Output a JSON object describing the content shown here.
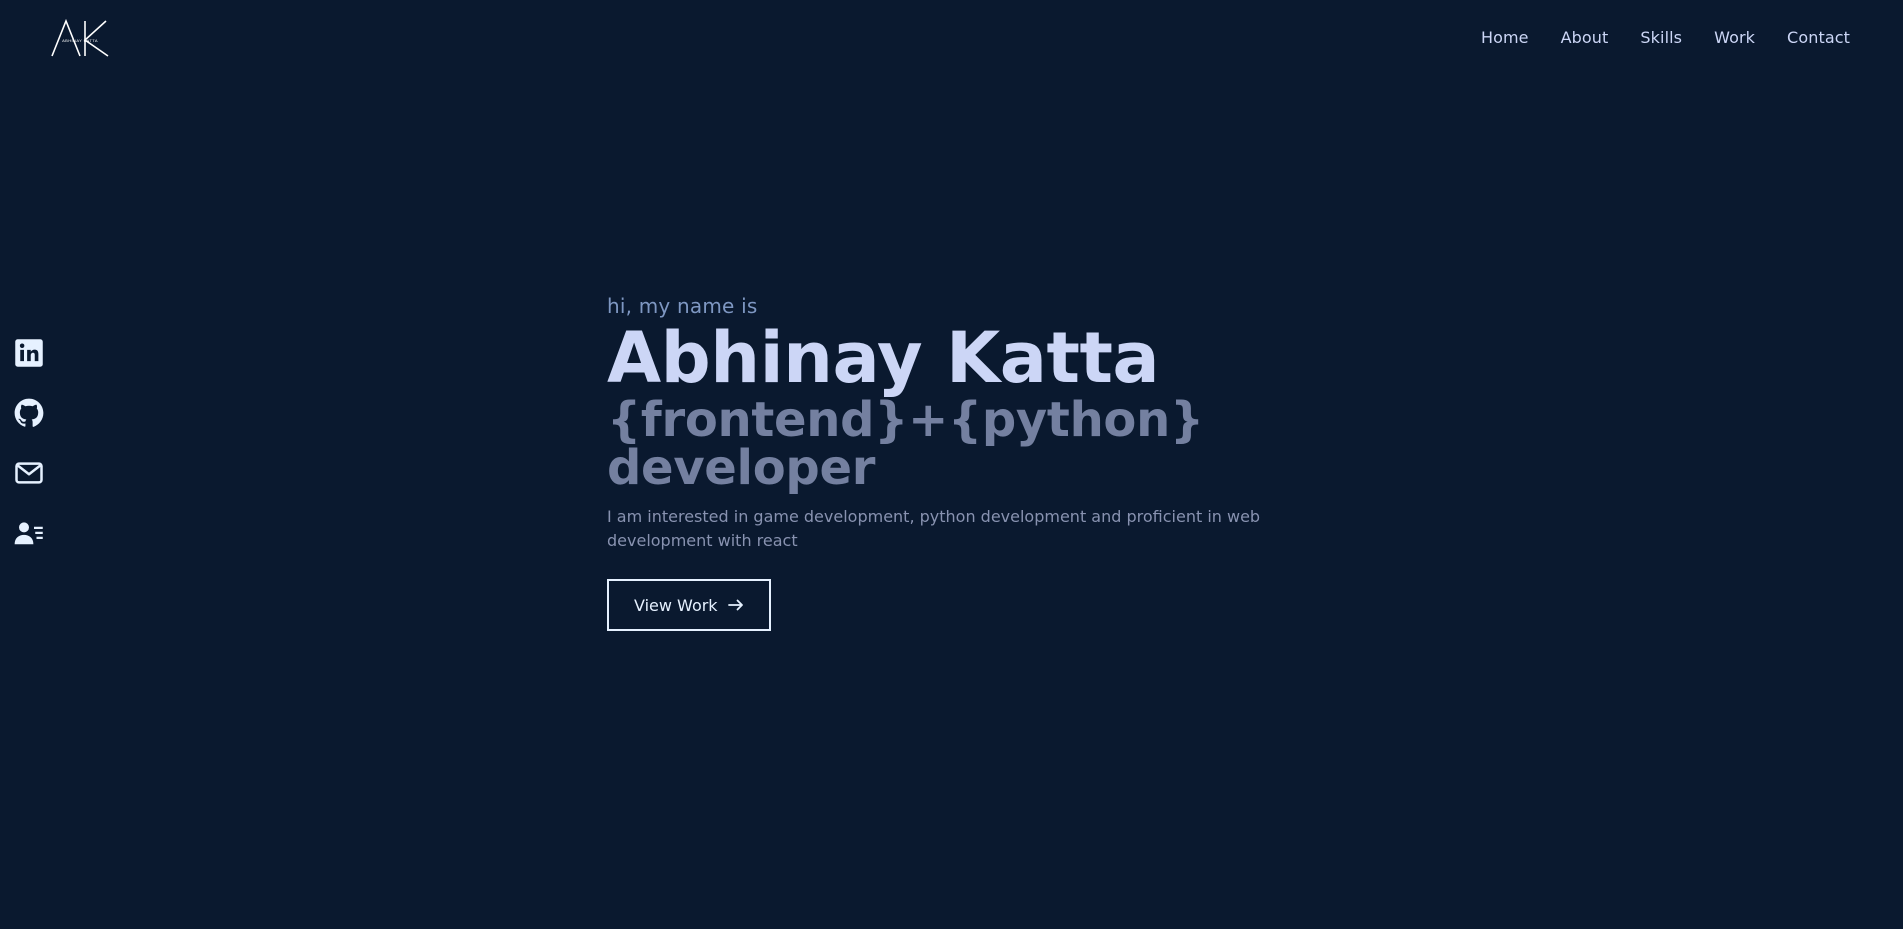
{
  "brand": {
    "logo_letters": "AK",
    "logo_subtext": "ABHINAY KATTA"
  },
  "nav": {
    "items": [
      {
        "label": "Home"
      },
      {
        "label": "About"
      },
      {
        "label": "Skills"
      },
      {
        "label": "Work"
      },
      {
        "label": "Contact"
      }
    ]
  },
  "social": {
    "items": [
      {
        "icon": "linkedin-icon"
      },
      {
        "icon": "github-icon"
      },
      {
        "icon": "mail-icon"
      },
      {
        "icon": "resume-icon"
      }
    ]
  },
  "hero": {
    "greeting": "hi, my name is",
    "name": "Abhinay Katta",
    "role_line1": "{frontend}+{python}",
    "role_line2": "developer",
    "description": "I am interested in game development, python development and proficient in web development with react",
    "cta_label": "View Work",
    "cta_icon": "arrow-right-icon"
  },
  "colors": {
    "background": "#0a192f",
    "heading": "#ccd6f6",
    "muted": "#8892b0",
    "accent_text": "#7e97c2"
  }
}
